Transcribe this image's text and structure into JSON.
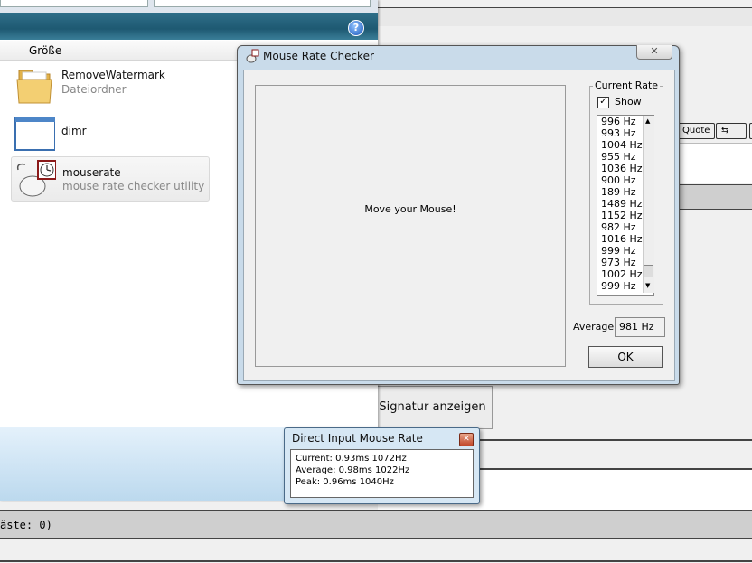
{
  "background": {
    "quote_button": "Quote",
    "signature_button": "Signatur anzeigen",
    "guests_text": "äste: 0)"
  },
  "explorer": {
    "column_header": "Größe",
    "files": [
      {
        "name": "RemoveWatermark",
        "desc": "Dateiordner"
      },
      {
        "name": "dimr",
        "desc": ""
      },
      {
        "name": "mouserate",
        "desc": "mouse rate checker utility"
      }
    ]
  },
  "mouse_rate_checker": {
    "title": "Mouse Rate Checker",
    "message": "Move your Mouse!",
    "group_label": "Current Rate",
    "show_label": "Show",
    "show_checked": true,
    "rates": [
      "996 Hz",
      "993 Hz",
      "1004 Hz",
      "955 Hz",
      "1036 Hz",
      "900 Hz",
      "189 Hz",
      "1489 Hz",
      "1152 Hz",
      "982 Hz",
      "1016 Hz",
      "999 Hz",
      "973 Hz",
      "1002 Hz",
      "999 Hz"
    ],
    "average_label": "Average",
    "average_value": "981 Hz",
    "ok_label": "OK"
  },
  "direct_input": {
    "title": "Direct Input Mouse Rate",
    "current": "Current: 0.93ms 1072Hz",
    "average": "Average: 0.98ms 1022Hz",
    "peak": "Peak: 0.96ms 1040Hz"
  }
}
